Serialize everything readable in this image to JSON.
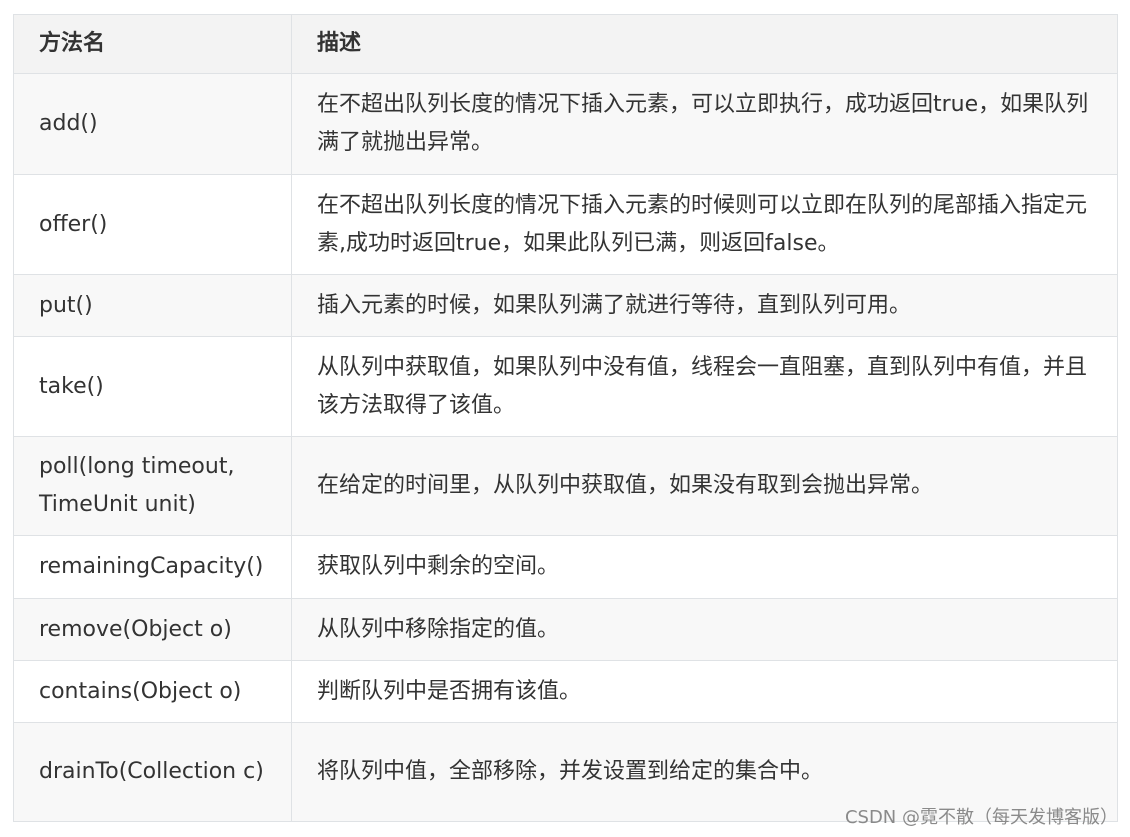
{
  "table": {
    "headers": [
      "方法名",
      "描述"
    ],
    "rows": [
      {
        "method": "add()",
        "desc": "在不超出队列长度的情况下插入元素，可以立即执行，成功返回true，如果队列满了就抛出异常。"
      },
      {
        "method": "offer()",
        "desc": "在不超出队列长度的情况下插入元素的时候则可以立即在队列的尾部插入指定元素,成功时返回true，如果此队列已满，则返回false。"
      },
      {
        "method": "put()",
        "desc": "插入元素的时候，如果队列满了就进行等待，直到队列可用。"
      },
      {
        "method": "take()",
        "desc": "从队列中获取值，如果队列中没有值，线程会一直阻塞，直到队列中有值，并且该方法取得了该值。"
      },
      {
        "method": "poll(long timeout, TimeUnit unit)",
        "desc": "在给定的时间里，从队列中获取值，如果没有取到会抛出异常。"
      },
      {
        "method": "remainingCapacity()",
        "desc": "获取队列中剩余的空间。"
      },
      {
        "method": "remove(Object o)",
        "desc": "从队列中移除指定的值。"
      },
      {
        "method": "contains(Object o)",
        "desc": "判断队列中是否拥有该值。"
      },
      {
        "method": "drainTo(Collection c)",
        "desc": "将队列中值，全部移除，并发设置到给定的集合中。"
      }
    ]
  },
  "watermark": "CSDN @霓不散（每天发博客版）"
}
